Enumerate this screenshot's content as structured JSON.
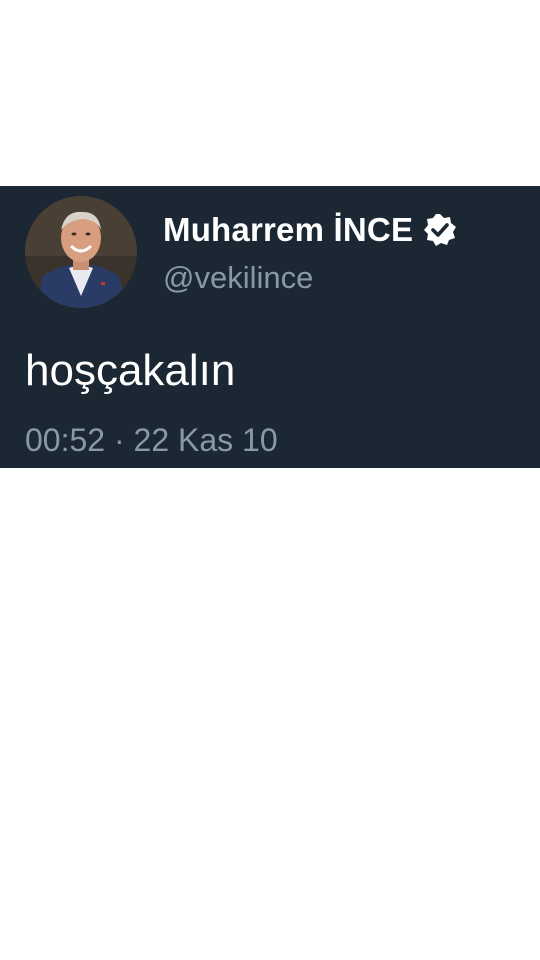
{
  "tweet": {
    "display_name": "Muharrem İNCE",
    "handle": "@vekilince",
    "text": "hoşçakalın",
    "timestamp": "00:52 · 22 Kas 10",
    "verified": true
  },
  "icons": {
    "verified": "verified-badge-icon",
    "avatar": "profile-photo"
  },
  "colors": {
    "card_background": "#1b2733",
    "name_text": "#ffffff",
    "secondary_text": "#8899a6",
    "page_background": "#ffffff"
  }
}
